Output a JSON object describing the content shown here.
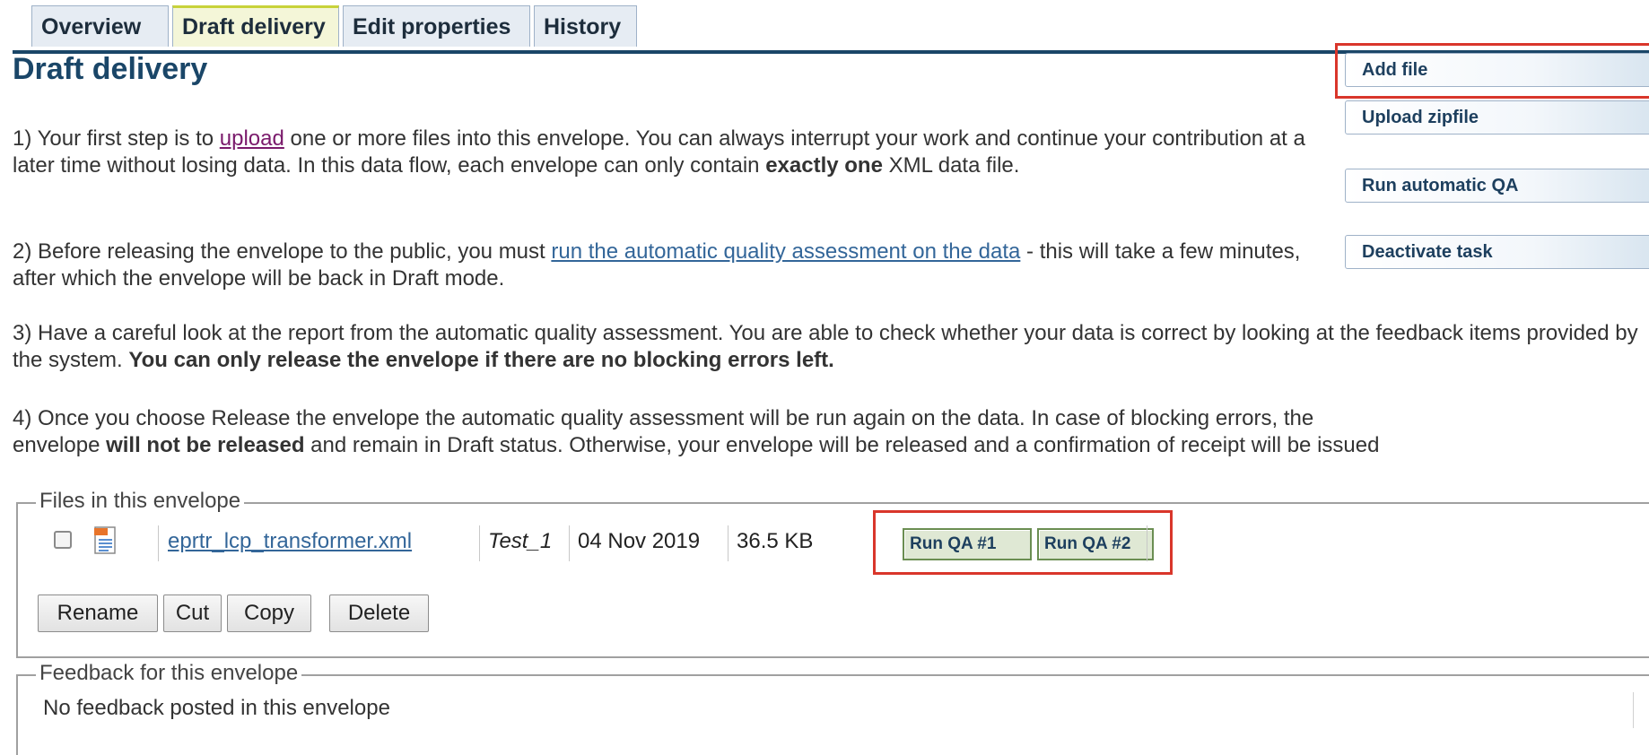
{
  "tabs": [
    {
      "label": "Overview"
    },
    {
      "label": "Draft delivery"
    },
    {
      "label": "Edit properties"
    },
    {
      "label": "History"
    }
  ],
  "active_tab": "Draft delivery",
  "page_title": "Draft delivery",
  "steps": {
    "p1_before": "1) Your first step is to ",
    "p1_link": "upload",
    "p1_mid": " one or more files into this envelope. You can always interrupt your work and continue your contribution at a later time without losing data. In this data flow, each envelope can only contain ",
    "p1_bold": "exactly one",
    "p1_after": " XML data file.",
    "p2_before": "2) Before releasing the envelope to the public, you must ",
    "p2_link": "run the automatic quality assessment on the data",
    "p2_after": " - this will take a few minutes, after which the envelope will be back in Draft mode.",
    "p3_before": "3) Have a careful look at the report from the automatic quality assessment. You are able to check whether your data is correct by looking at the feedback items provided by the system. ",
    "p3_bold": "You can only release the envelope if there are no blocking errors left.",
    "p4_line1": "4) Once you choose Release the envelope the automatic quality assessment will be run again on the data. In case of blocking errors, the",
    "p4_line2_before": "envelope ",
    "p4_line2_bold": "will not be released",
    "p4_line2_after": " and remain in Draft status. Otherwise, your envelope will be released and a confirmation of receipt will be issued"
  },
  "side_actions": {
    "add_file": "Add file",
    "upload_zip": "Upload zipfile",
    "run_qa": "Run automatic QA",
    "deactivate": "Deactivate task"
  },
  "files": {
    "legend": "Files in this envelope",
    "rows": [
      {
        "name": "eprtr_lcp_transformer.xml",
        "title": "Test_1",
        "date": "04 Nov 2019",
        "size": "36.5 KB",
        "qa_buttons": [
          "Run QA #1",
          "Run QA #2"
        ],
        "icon": "xml-file-icon",
        "checked": false
      }
    ],
    "actions": {
      "rename": "Rename",
      "cut": "Cut",
      "copy": "Copy",
      "delete": "Delete"
    }
  },
  "feedback": {
    "legend": "Feedback for this envelope",
    "empty_text": "No feedback posted in this envelope"
  },
  "colors": {
    "title": "#1a4668",
    "link": "#336699",
    "visited_link": "#7a1a6b",
    "highlight": "#d9362b"
  }
}
